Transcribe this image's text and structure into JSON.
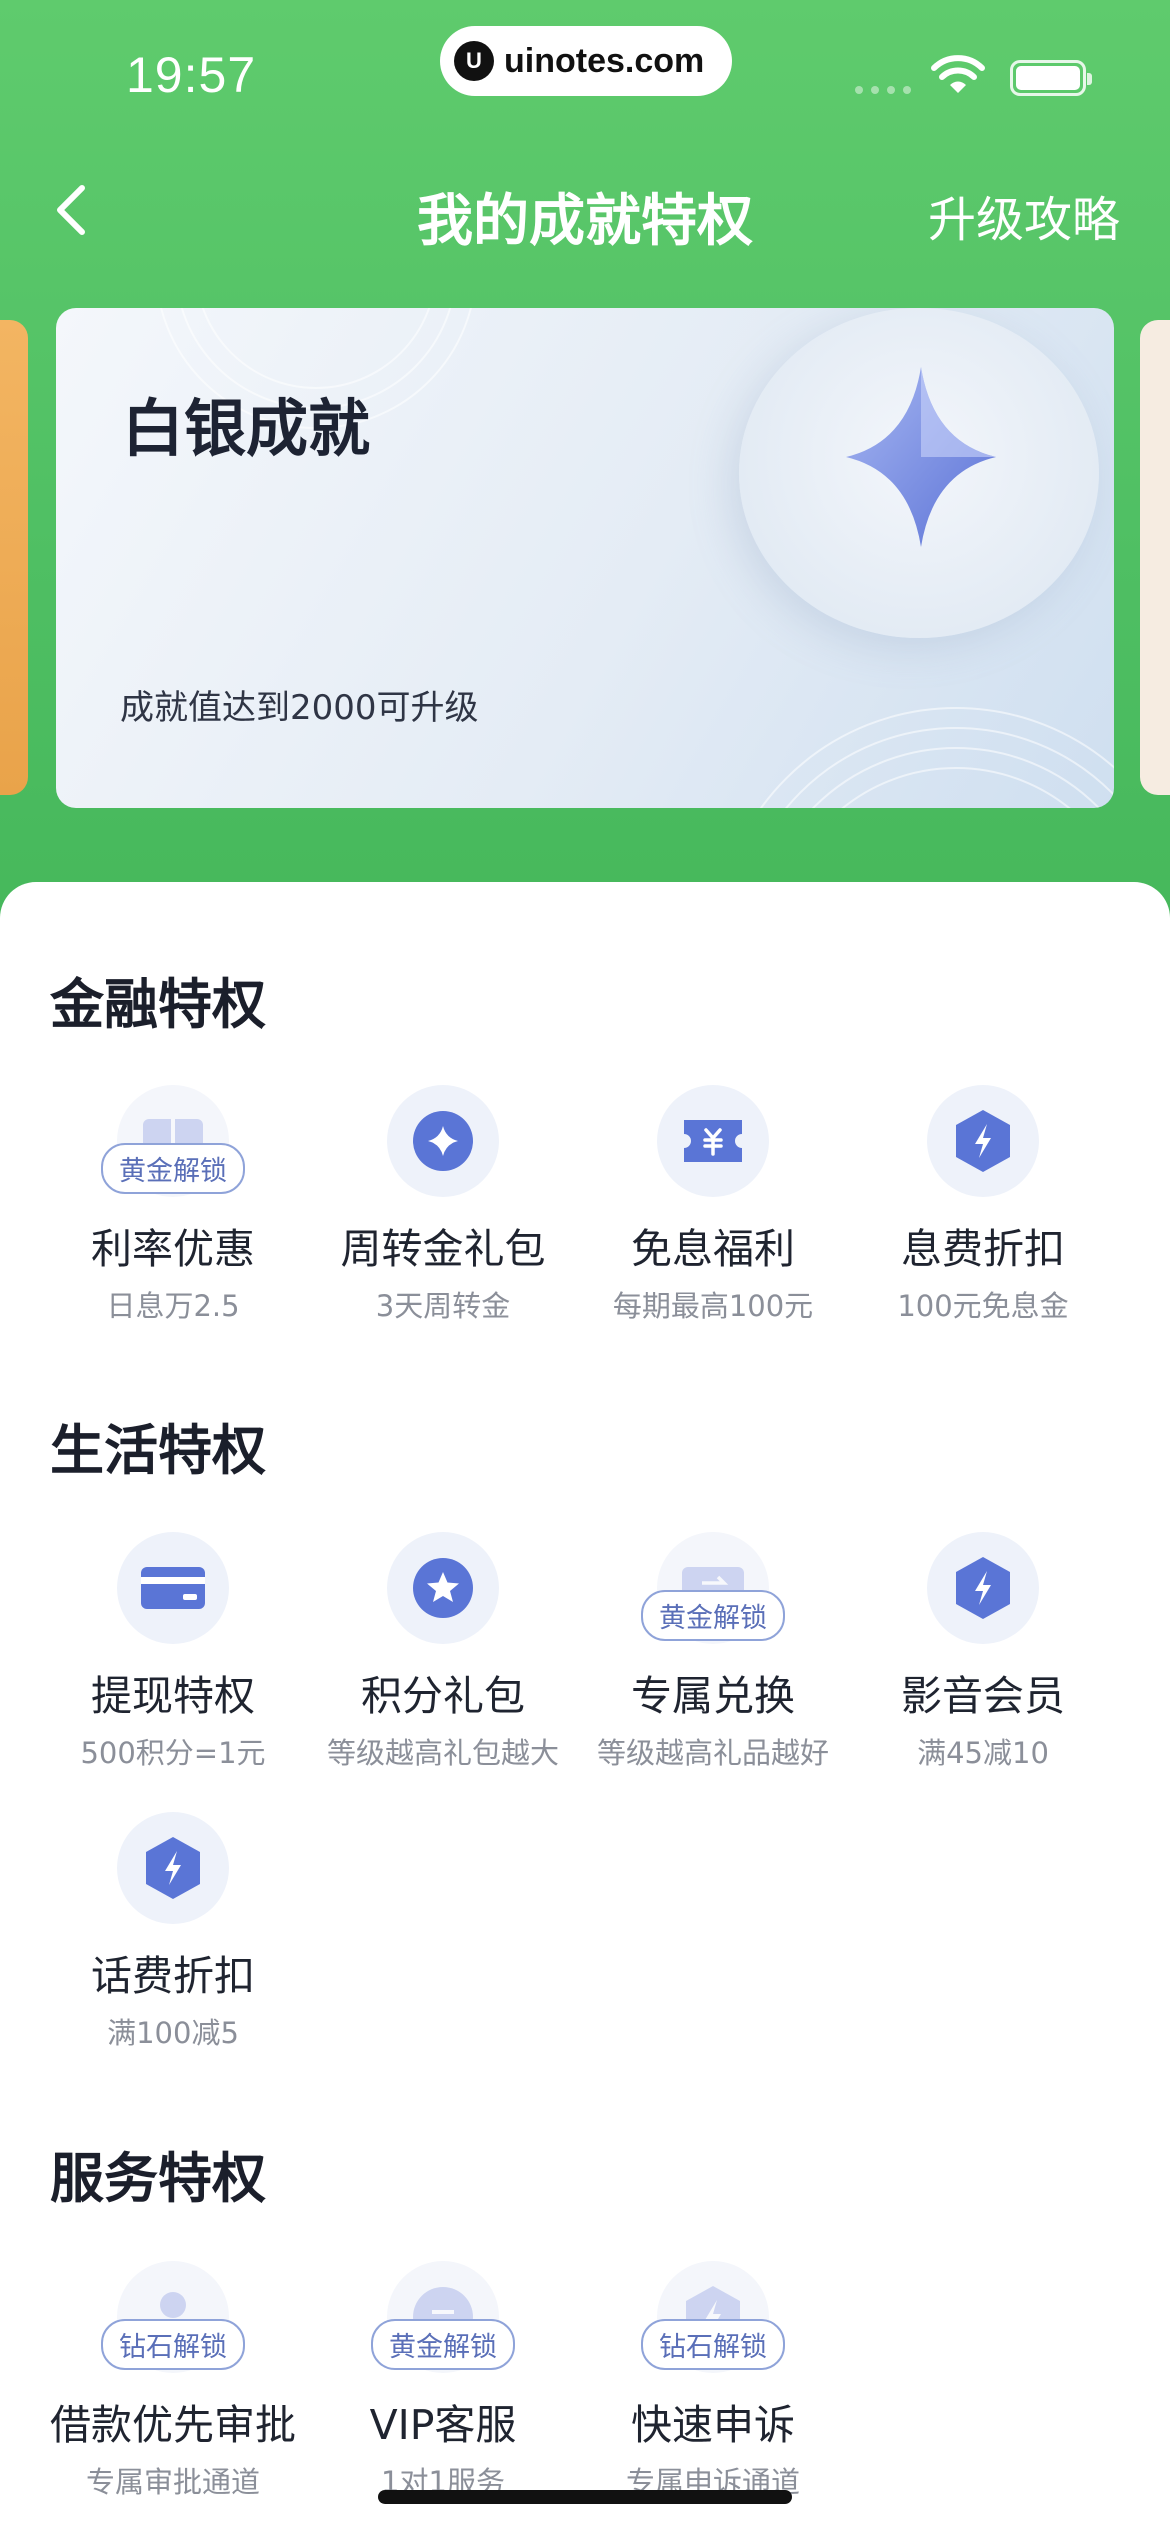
{
  "status_bar": {
    "time": "19:57",
    "url": "uinotes.com",
    "logo_letter": "U"
  },
  "nav": {
    "title": "我的成就特权",
    "right_link": "升级攻略"
  },
  "card": {
    "title": "白银成就",
    "subtitle": "成就值达到2000可升级"
  },
  "sections": {
    "finance": {
      "title": "金融特权",
      "items": [
        {
          "name": "利率优惠",
          "desc": "日息万2.5",
          "badge": "黄金解锁",
          "icon": "book-icon"
        },
        {
          "name": "周转金礼包",
          "desc": "3天周转金",
          "icon": "sparkle-icon"
        },
        {
          "name": "免息福利",
          "desc": "每期最高100元",
          "icon": "yuan-coupon-icon"
        },
        {
          "name": "息费折扣",
          "desc": "100元免息金",
          "icon": "lightning-hexagon-icon"
        }
      ]
    },
    "life": {
      "title": "生活特权",
      "items": [
        {
          "name": "提现特权",
          "desc": "500积分=1元",
          "icon": "card-icon"
        },
        {
          "name": "积分礼包",
          "desc": "等级越高礼包越大",
          "icon": "star-icon"
        },
        {
          "name": "专属兑换",
          "desc": "等级越高礼品越好",
          "badge": "黄金解锁",
          "icon": "exchange-icon"
        },
        {
          "name": "影音会员",
          "desc": "满45减10",
          "icon": "lightning-hexagon-icon"
        },
        {
          "name": "话费折扣",
          "desc": "满100减5",
          "icon": "lightning-hexagon-icon"
        }
      ]
    },
    "service": {
      "title": "服务特权",
      "items": [
        {
          "name": "借款优先审批",
          "desc": "专属审批通道",
          "badge": "钻石解锁",
          "icon": "person-icon"
        },
        {
          "name": "VIP客服",
          "desc": "1对1服务",
          "badge": "黄金解锁",
          "icon": "chat-icon"
        },
        {
          "name": "快速申诉",
          "desc": "专属申诉通道",
          "badge": "钻石解锁",
          "icon": "lightning-hexagon-icon"
        }
      ]
    }
  },
  "colors": {
    "accent_green": "#4fbf63",
    "icon_blue": "#5a75d6",
    "badge_blue": "#5a6fb8"
  }
}
